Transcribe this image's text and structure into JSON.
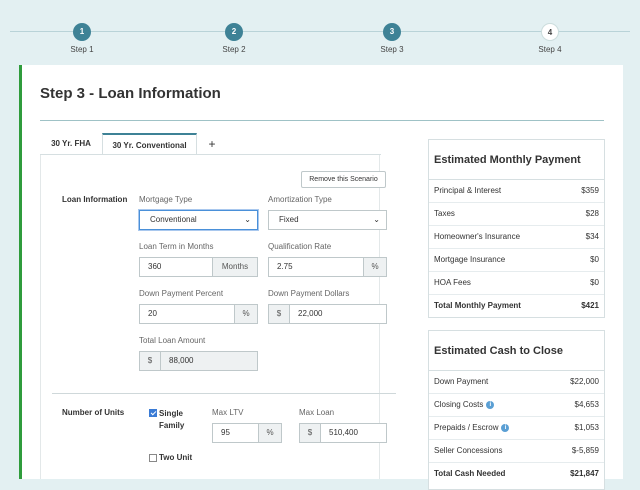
{
  "steps": [
    {
      "number": "1",
      "label": "Step 1",
      "state": "done"
    },
    {
      "number": "2",
      "label": "Step 2",
      "state": "done"
    },
    {
      "number": "3",
      "label": "Step 3",
      "state": "current"
    },
    {
      "number": "4",
      "label": "Step 4",
      "state": "pending"
    }
  ],
  "colors": {
    "accent": "#3e8296",
    "green_edge": "#2f9c3c",
    "page_bg": "#e3f0f2"
  },
  "page_title": "Step 3 - Loan Information",
  "tabs": [
    {
      "label": "30 Yr. FHA",
      "active": false
    },
    {
      "label": "30 Yr. Conventional",
      "active": true
    },
    {
      "label": "+",
      "active": false
    }
  ],
  "remove_scenario_label": "Remove this Scenario",
  "loan_info": {
    "section_label": "Loan Information",
    "mortgage_type": {
      "label": "Mortgage Type",
      "value": "Conventional"
    },
    "amortization_type": {
      "label": "Amortization Type",
      "value": "Fixed"
    },
    "loan_term": {
      "label": "Loan Term in Months",
      "value": "360",
      "unit": "Months"
    },
    "qualification_rate": {
      "label": "Qualification Rate",
      "value": "2.75",
      "unit": "%"
    },
    "down_payment_percent": {
      "label": "Down Payment Percent",
      "value": "20",
      "unit": "%"
    },
    "down_payment_dollars": {
      "label": "Down Payment Dollars",
      "prefix": "$",
      "value": "22,000"
    },
    "total_loan_amount": {
      "label": "Total Loan Amount",
      "prefix": "$",
      "value": "88,000"
    }
  },
  "units": {
    "section_label": "Number of Units",
    "single_family": {
      "label": "Single Family",
      "checked": true
    },
    "two_unit": {
      "label": "Two Unit",
      "checked": false
    },
    "max_ltv": {
      "label": "Max LTV",
      "value": "95",
      "unit": "%"
    },
    "max_loan": {
      "label": "Max Loan",
      "prefix": "$",
      "value": "510,400"
    }
  },
  "monthly_payment": {
    "title": "Estimated Monthly Payment",
    "rows": [
      {
        "label": "Principal & Interest",
        "value": "$359"
      },
      {
        "label": "Taxes",
        "value": "$28"
      },
      {
        "label": "Homeowner's Insurance",
        "value": "$34"
      },
      {
        "label": "Mortgage Insurance",
        "value": "$0"
      },
      {
        "label": "HOA Fees",
        "value": "$0"
      }
    ],
    "total_label": "Total Monthly Payment",
    "total_value": "$421"
  },
  "cash_to_close": {
    "title": "Estimated Cash to Close",
    "rows": [
      {
        "label": "Down Payment",
        "value": "$22,000",
        "info": false
      },
      {
        "label": "Closing Costs",
        "value": "$4,653",
        "info": true
      },
      {
        "label": "Prepaids / Escrow",
        "value": "$1,053",
        "info": true
      },
      {
        "label": "Seller Concessions",
        "value": "$-5,859",
        "info": false
      }
    ],
    "total_label": "Total Cash Needed",
    "total_value": "$21,847"
  }
}
